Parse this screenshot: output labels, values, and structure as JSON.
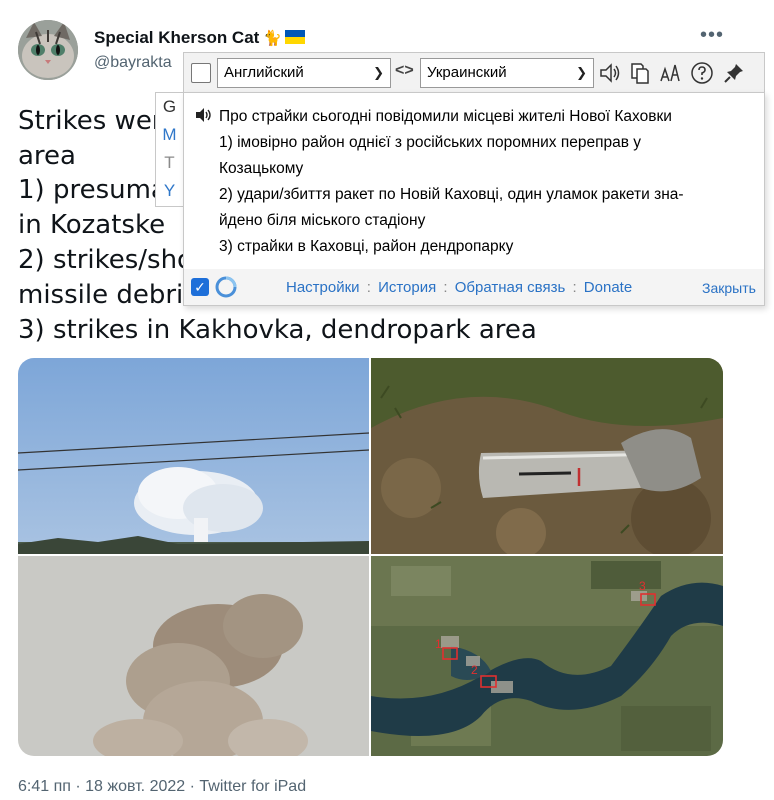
{
  "tweet": {
    "author_name": "Special Kherson Cat",
    "name_emoji": "🐈",
    "handle": "@bayrakta",
    "more_label": "•••",
    "text_lines": [
      "Strikes wer",
      "area",
      "1) presuma",
      "in Kozatske",
      "2) strikes/sho",
      "missile debris",
      "3) strikes in Kakhovka, dendropark area"
    ],
    "map_markers": [
      "1",
      "2",
      "3"
    ],
    "meta": "6:41 пп · 18 жовт. 2022 · Twitter for iPad"
  },
  "translator": {
    "source_lang": "Английский",
    "target_lang": "Украинский",
    "swap_label": "<>",
    "side_tabs": [
      "G",
      "M",
      "T",
      "Y"
    ],
    "translation_lines": [
      "Про страйки сьогодні повідомили місцеві жителі Нової Каховки",
      "1) імовірно район однієї з російських поромних переправ у",
      "Козацькому",
      "2) удари/збиття ракет по Новій Каховці, один уламок ракети зна-",
      "йдено біля міського стадіону",
      "3) страйки в Каховці, район дендропарку"
    ],
    "footer_links": [
      "Настройки",
      "История",
      "Обратная связь",
      "Donate"
    ],
    "footer_sep": ":",
    "close_label": "Закрыть",
    "accent_color": "#2a72c5",
    "check_color": "#1e6fd9"
  }
}
